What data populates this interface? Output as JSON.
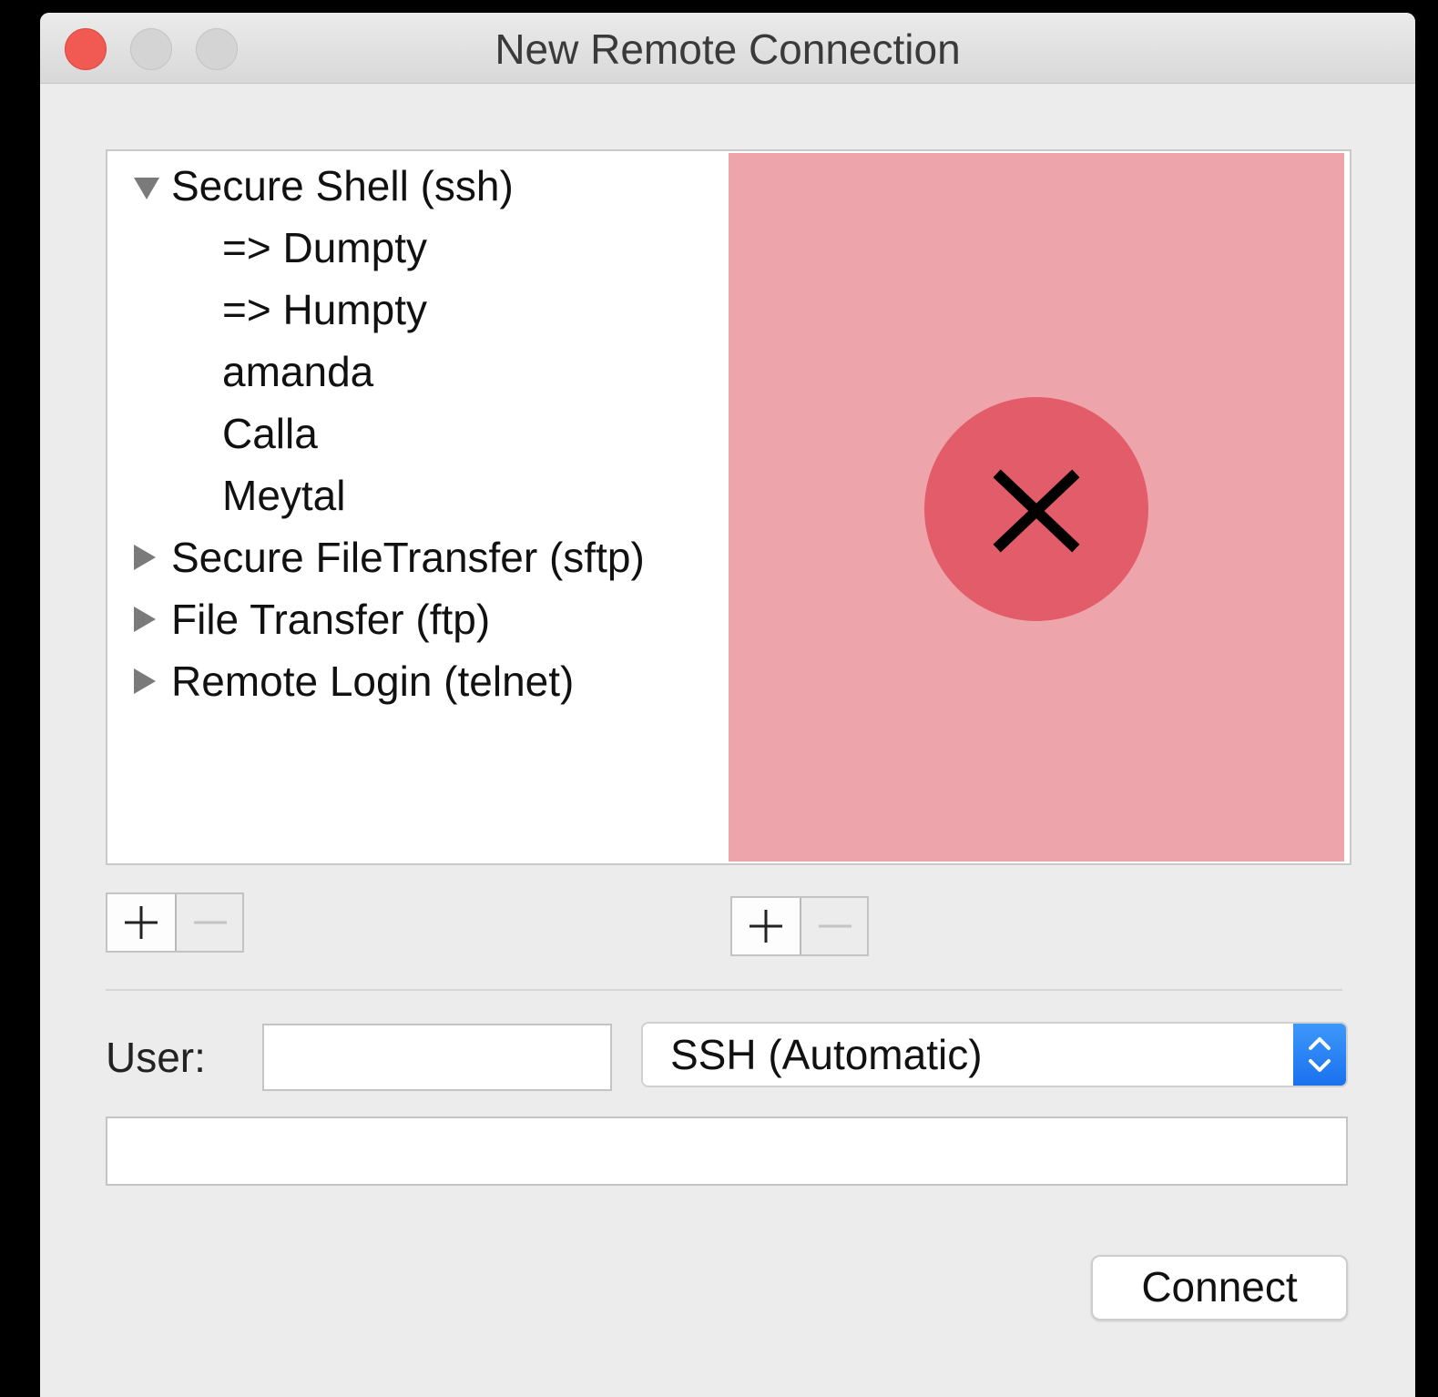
{
  "window": {
    "title": "New Remote Connection"
  },
  "services": [
    {
      "label": "Secure Shell (ssh)",
      "expanded": true,
      "children": [
        "=> Dumpty",
        "=> Humpty",
        "amanda",
        "Calla",
        "Meytal"
      ]
    },
    {
      "label": "Secure FileTransfer (sftp)",
      "expanded": false
    },
    {
      "label": "File Transfer (ftp)",
      "expanded": false
    },
    {
      "label": "Remote Login (telnet)",
      "expanded": false
    }
  ],
  "drop_zone": {
    "color": "#eea4ab",
    "badge_color": "#e25d69",
    "icon": "close-icon"
  },
  "form": {
    "user_label": "User:",
    "user_value": "",
    "protocol_selected": "SSH (Automatic)",
    "host_value": "",
    "connect_label": "Connect"
  },
  "colors": {
    "close_button": "#f05a52",
    "stepper_accent": "#1a71ee"
  }
}
